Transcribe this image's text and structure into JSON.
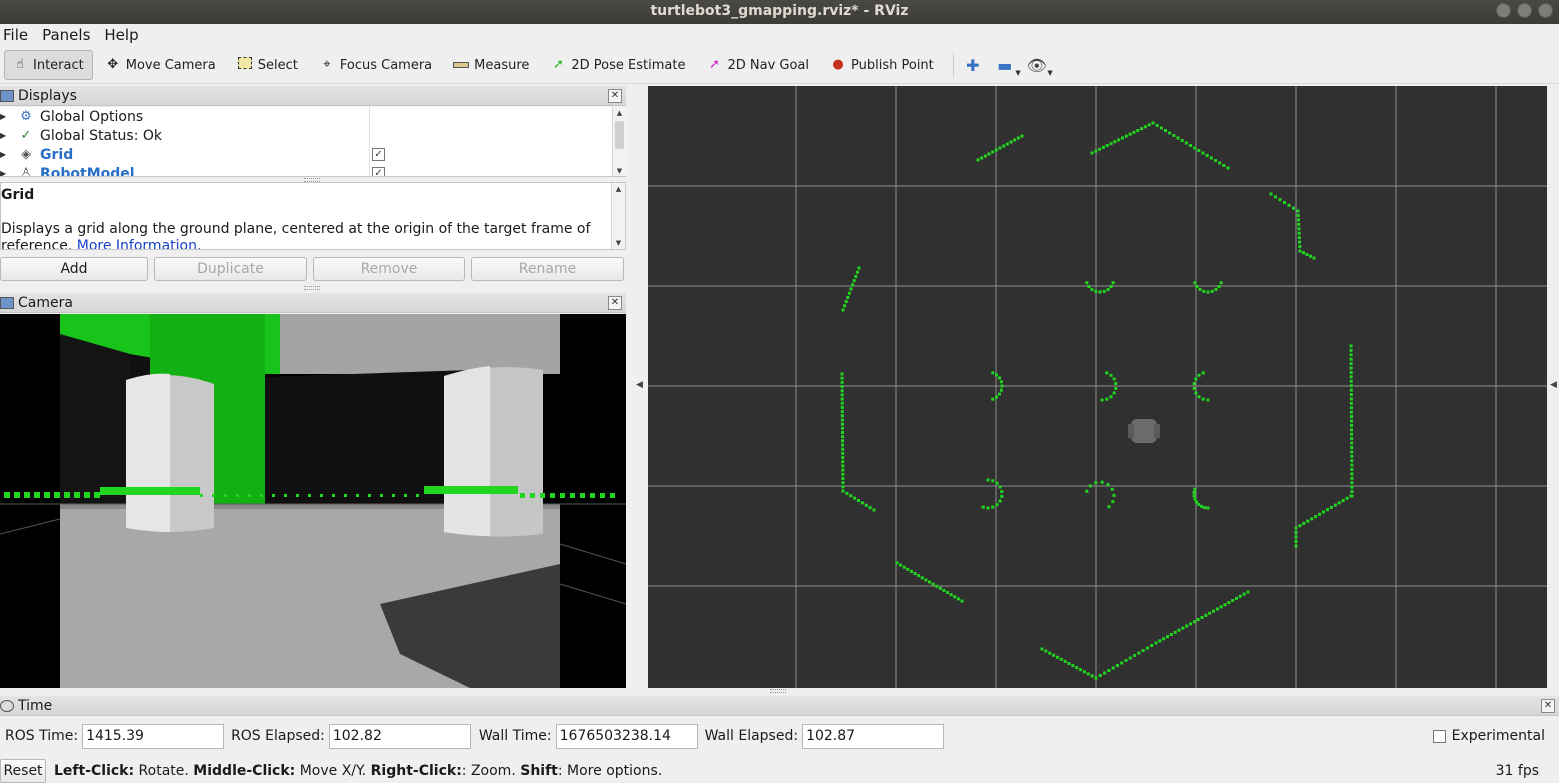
{
  "window": {
    "title": "turtlebot3_gmapping.rviz* - RViz"
  },
  "menu": [
    "File",
    "Panels",
    "Help"
  ],
  "toolbar": {
    "tools": [
      {
        "label": "Interact",
        "icon": "hand-pointer-icon"
      },
      {
        "label": "Move Camera",
        "icon": "move-camera-icon"
      },
      {
        "label": "Select",
        "icon": "select-box-icon"
      },
      {
        "label": "Focus Camera",
        "icon": "focus-crosshair-icon"
      },
      {
        "label": "Measure",
        "icon": "ruler-icon"
      },
      {
        "label": "2D Pose Estimate",
        "icon": "green-arrow-icon"
      },
      {
        "label": "2D Nav Goal",
        "icon": "magenta-arrow-icon"
      },
      {
        "label": "Publish Point",
        "icon": "map-pin-icon"
      }
    ],
    "active": "Interact"
  },
  "displays_panel": {
    "title": "Displays",
    "items": [
      {
        "label": "Global Options",
        "icon": "gear-icon",
        "checked": null
      },
      {
        "label": "Global Status: Ok",
        "icon": "check-icon",
        "checked": null
      },
      {
        "label": "Grid",
        "icon": "grid-icon",
        "checked": true
      },
      {
        "label": "RobotModel",
        "icon": "robot-icon",
        "checked": true
      }
    ],
    "description_title": "Grid",
    "description_text": "Displays a grid along the ground plane, centered at the origin of the target frame of reference.",
    "description_link": "More Information.",
    "buttons": {
      "add": "Add",
      "duplicate": "Duplicate",
      "remove": "Remove",
      "rename": "Rename"
    }
  },
  "camera_panel": {
    "title": "Camera"
  },
  "time_panel": {
    "title": "Time",
    "ros_time_label": "ROS Time:",
    "ros_time": "1415.39",
    "ros_elapsed_label": "ROS Elapsed:",
    "ros_elapsed": "102.82",
    "wall_time_label": "Wall Time:",
    "wall_time": "1676503238.14",
    "wall_elapsed_label": "Wall Elapsed:",
    "wall_elapsed": "102.87",
    "experimental_label": "Experimental",
    "experimental_checked": false
  },
  "status": {
    "reset_label": "Reset",
    "left_click": "Left-Click:",
    "left_click_action": "Rotate.",
    "middle_click": "Middle-Click:",
    "middle_click_action": "Move X/Y.",
    "right_click": "Right-Click:",
    "right_click_action": ": Zoom.",
    "shift": "Shift",
    "shift_action": ": More options.",
    "fps": "31 fps"
  },
  "colors": {
    "laser_scan": "#21d61f",
    "grid_line": "#9a9a9a",
    "viewport_bg": "#303030",
    "link": "#2a6fc7"
  }
}
